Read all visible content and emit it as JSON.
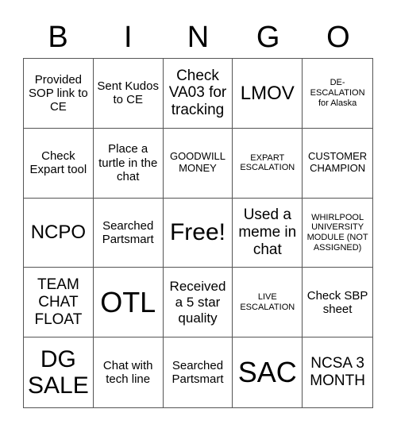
{
  "header": {
    "letters": [
      "B",
      "I",
      "N",
      "G",
      "O"
    ]
  },
  "cells": [
    "Provided SOP link to CE",
    "Sent Kudos to CE",
    "Check VA03 for tracking",
    "LMOV",
    "DE-ESCALATION for Alaska",
    "Check Expart tool",
    "Place a turtle in the chat",
    "GOODWILL MONEY",
    "EXPART ESCALATION",
    "CUSTOMER CHAMPION",
    "NCPO",
    "Searched Partsmart",
    "Free!",
    "Used a meme in chat",
    "WHIRLPOOL UNIVERSITY MODULE (NOT ASSIGNED)",
    "TEAM CHAT FLOAT",
    "OTL",
    "Received a 5 star quality",
    "LIVE ESCALATION",
    "Check SBP sheet",
    "DG SALE",
    "Chat with tech line",
    "Searched Partsmart",
    "SAC",
    "NCSA 3 MONTH"
  ]
}
